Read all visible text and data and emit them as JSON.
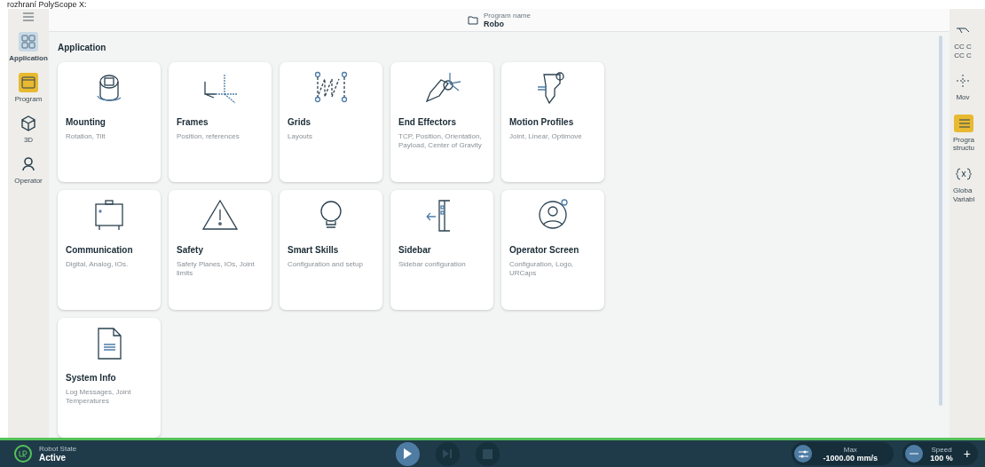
{
  "caption": "rozhraní PolyScope X:",
  "header": {
    "label": "Program name",
    "value": "Robo"
  },
  "left_rail": [
    {
      "label": "Application",
      "selected": true,
      "highlighted": false
    },
    {
      "label": "Program",
      "selected": false,
      "highlighted": true
    },
    {
      "label": "3D",
      "selected": false,
      "highlighted": false
    },
    {
      "label": "Operator",
      "selected": false,
      "highlighted": false
    }
  ],
  "section_title": "Application",
  "cards": [
    {
      "title": "Mounting",
      "subtitle": "Rotation, Tilt"
    },
    {
      "title": "Frames",
      "subtitle": "Position, references"
    },
    {
      "title": "Grids",
      "subtitle": "Layouts"
    },
    {
      "title": "End Effectors",
      "subtitle": "TCP, Position, Orientation, Payload, Center of Gravity"
    },
    {
      "title": "Motion Profiles",
      "subtitle": "Joint, Linear, Optimove"
    },
    {
      "title": "Communication",
      "subtitle": "Digital, Analog, IOs."
    },
    {
      "title": "Safety",
      "subtitle": "Safety Planes, IOs, Joint limits"
    },
    {
      "title": "Smart Skills",
      "subtitle": "Configuration and setup"
    },
    {
      "title": "Sidebar",
      "subtitle": "Sidebar configuration"
    },
    {
      "title": "Operator Screen",
      "subtitle": "Configuration, Logo, URCaps"
    },
    {
      "title": "System Info",
      "subtitle": "Log Messages, Joint Temperatures"
    }
  ],
  "right_rail": [
    {
      "lines": [
        "CC C",
        "CC C"
      ],
      "highlighted": false
    },
    {
      "lines": [
        "Mov"
      ],
      "highlighted": false
    },
    {
      "lines": [
        "Progra",
        "structu"
      ],
      "highlighted": true
    },
    {
      "lines": [
        "Globa",
        "Variabl"
      ],
      "highlighted": false
    }
  ],
  "status_bar": {
    "state_label": "Robot State",
    "state_value": "Active",
    "max_label": "Max",
    "max_value": "-1000.00 mm/s",
    "speed_label": "Speed",
    "speed_value": "100 %",
    "plus": "+"
  }
}
